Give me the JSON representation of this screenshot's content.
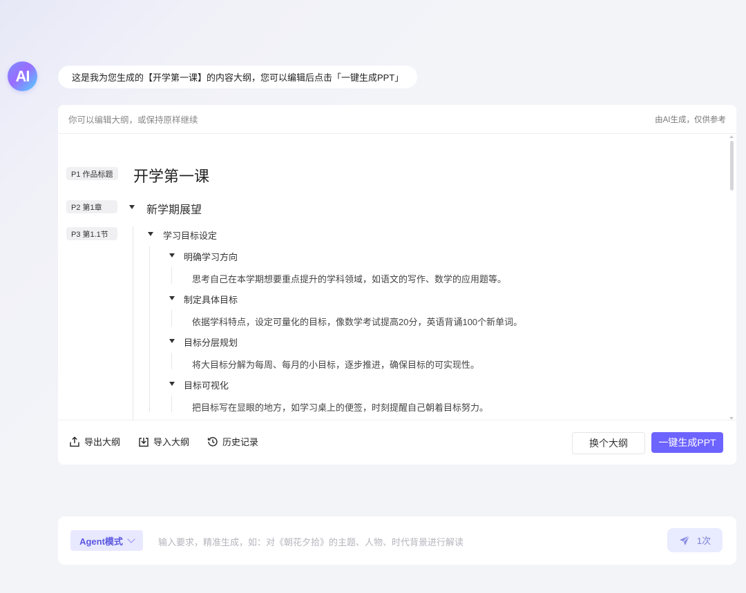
{
  "assistant": {
    "avatar_label": "AI",
    "message": "这是我为您生成的【开学第一课】的内容大纲，您可以编辑后点击「一键生成PPT」"
  },
  "card": {
    "hint": "你可以编辑大纲，或保持原样继续",
    "disclaimer": "由AI生成，仅供参考"
  },
  "outline": {
    "title_tag": "P1 作品标题",
    "title": "开学第一课",
    "chapter_tag": "P2 第1章",
    "chapter": "新学期展望",
    "section_tag": "P3 第1.1节",
    "section": "学习目标设定",
    "items": [
      {
        "heading": "明确学习方向",
        "detail": "思考自己在本学期想要重点提升的学科领域，如语文的写作、数学的应用题等。"
      },
      {
        "heading": "制定具体目标",
        "detail": "依据学科特点，设定可量化的目标，像数学考试提高20分，英语背诵100个新单词。"
      },
      {
        "heading": "目标分层规划",
        "detail": "将大目标分解为每周、每月的小目标，逐步推进，确保目标的可实现性。"
      },
      {
        "heading": "目标可视化",
        "detail": "把目标写在显眼的地方，如学习桌上的便签，时刻提醒自己朝着目标努力。"
      }
    ]
  },
  "footer": {
    "export": "导出大纲",
    "import": "导入大纲",
    "history": "历史记录",
    "switch_outline": "换个大纲",
    "generate": "一键生成PPT"
  },
  "input": {
    "mode": "Agent模式",
    "placeholder": "输入要求，精准生成，如：对《朝花夕拾》的主题、人物、时代背景进行解读",
    "send_count": "1次"
  }
}
